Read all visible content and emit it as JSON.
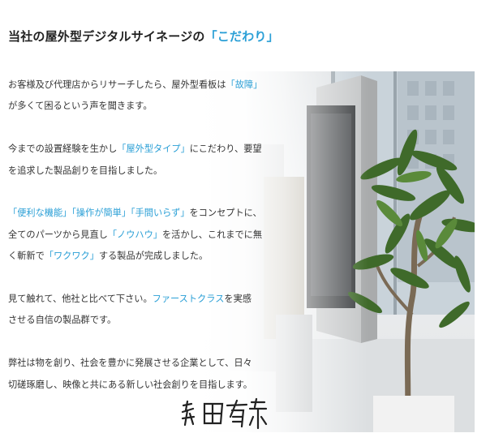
{
  "heading": {
    "text": "当社の屋外型デジタルサイネージの",
    "accent": "「こだわり」"
  },
  "colors": {
    "accent": "#2a9fd6",
    "text": "#333333"
  },
  "paragraphs": [
    [
      [
        {
          "t": "お客様及び代理店からリサーチしたら、屋外型看板は"
        },
        {
          "t": "「故障」",
          "hl": true
        }
      ],
      [
        {
          "t": "が多くて困るという声を聞きます。"
        }
      ]
    ],
    [
      [
        {
          "t": "今までの設置経験を生かし"
        },
        {
          "t": "「屋外型タイプ」",
          "hl": true
        },
        {
          "t": "にこだわり、要望"
        }
      ],
      [
        {
          "t": "を追求した製品創りを目指しました。"
        }
      ]
    ],
    [
      [
        {
          "t": "「便利な機能」「操作が簡単」「手間いらず」",
          "hl": true
        },
        {
          "t": "をコンセプトに、"
        }
      ],
      [
        {
          "t": "全てのパーツから見直し"
        },
        {
          "t": "「ノウハウ」",
          "hl": true
        },
        {
          "t": "を活かし、これまでに無"
        }
      ],
      [
        {
          "t": "く斬新で"
        },
        {
          "t": "「ワクワク」",
          "hl": true
        },
        {
          "t": "する製品が完成しました。"
        }
      ]
    ],
    [
      [
        {
          "t": "見て触れて、他社と比べて下さい。"
        },
        {
          "t": "ファーストクラス",
          "hl": true
        },
        {
          "t": "を実感"
        }
      ],
      [
        {
          "t": "させる自信の製品群です。"
        }
      ]
    ],
    [
      [
        {
          "t": "弊社は物を創り、社会を豊かに発展させる企業として、日々"
        }
      ],
      [
        {
          "t": "切磋琢磨し、映像と共にある新しい社会創りを目指します。"
        }
      ]
    ]
  ],
  "signature": {
    "text": "篠田有紫"
  },
  "photo": {
    "subject": "outdoor-digital-signage-kiosk-with-potted-plant"
  }
}
